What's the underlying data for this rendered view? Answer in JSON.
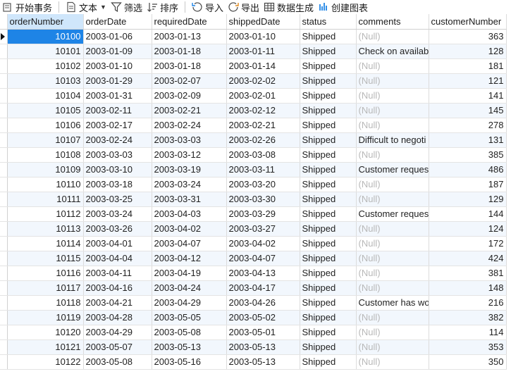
{
  "toolbar": {
    "begin_tx": "开始事务",
    "text": "文本",
    "filter": "筛选",
    "sort": "排序",
    "import": "导入",
    "export": "导出",
    "data_gen": "数据生成",
    "create_chart": "创建图表"
  },
  "columns": [
    "orderNumber",
    "orderDate",
    "requiredDate",
    "shippedDate",
    "status",
    "comments",
    "customerNumber"
  ],
  "null_text": "(Null)",
  "rows": [
    [
      "10100",
      "2003-01-06",
      "2003-01-13",
      "2003-01-10",
      "Shipped",
      "(Null)",
      "363"
    ],
    [
      "10101",
      "2003-01-09",
      "2003-01-18",
      "2003-01-11",
      "Shipped",
      "Check on availabi",
      "128"
    ],
    [
      "10102",
      "2003-01-10",
      "2003-01-18",
      "2003-01-14",
      "Shipped",
      "(Null)",
      "181"
    ],
    [
      "10103",
      "2003-01-29",
      "2003-02-07",
      "2003-02-02",
      "Shipped",
      "(Null)",
      "121"
    ],
    [
      "10104",
      "2003-01-31",
      "2003-02-09",
      "2003-02-01",
      "Shipped",
      "(Null)",
      "141"
    ],
    [
      "10105",
      "2003-02-11",
      "2003-02-21",
      "2003-02-12",
      "Shipped",
      "(Null)",
      "145"
    ],
    [
      "10106",
      "2003-02-17",
      "2003-02-24",
      "2003-02-21",
      "Shipped",
      "(Null)",
      "278"
    ],
    [
      "10107",
      "2003-02-24",
      "2003-03-03",
      "2003-02-26",
      "Shipped",
      "Difficult to negoti",
      "131"
    ],
    [
      "10108",
      "2003-03-03",
      "2003-03-12",
      "2003-03-08",
      "Shipped",
      "(Null)",
      "385"
    ],
    [
      "10109",
      "2003-03-10",
      "2003-03-19",
      "2003-03-11",
      "Shipped",
      "Customer request",
      "486"
    ],
    [
      "10110",
      "2003-03-18",
      "2003-03-24",
      "2003-03-20",
      "Shipped",
      "(Null)",
      "187"
    ],
    [
      "10111",
      "2003-03-25",
      "2003-03-31",
      "2003-03-30",
      "Shipped",
      "(Null)",
      "129"
    ],
    [
      "10112",
      "2003-03-24",
      "2003-04-03",
      "2003-03-29",
      "Shipped",
      "Customer request",
      "144"
    ],
    [
      "10113",
      "2003-03-26",
      "2003-04-02",
      "2003-03-27",
      "Shipped",
      "(Null)",
      "124"
    ],
    [
      "10114",
      "2003-04-01",
      "2003-04-07",
      "2003-04-02",
      "Shipped",
      "(Null)",
      "172"
    ],
    [
      "10115",
      "2003-04-04",
      "2003-04-12",
      "2003-04-07",
      "Shipped",
      "(Null)",
      "424"
    ],
    [
      "10116",
      "2003-04-11",
      "2003-04-19",
      "2003-04-13",
      "Shipped",
      "(Null)",
      "381"
    ],
    [
      "10117",
      "2003-04-16",
      "2003-04-24",
      "2003-04-17",
      "Shipped",
      "(Null)",
      "148"
    ],
    [
      "10118",
      "2003-04-21",
      "2003-04-29",
      "2003-04-26",
      "Shipped",
      "Customer has wor",
      "216"
    ],
    [
      "10119",
      "2003-04-28",
      "2003-05-05",
      "2003-05-02",
      "Shipped",
      "(Null)",
      "382"
    ],
    [
      "10120",
      "2003-04-29",
      "2003-05-08",
      "2003-05-01",
      "Shipped",
      "(Null)",
      "114"
    ],
    [
      "10121",
      "2003-05-07",
      "2003-05-13",
      "2003-05-13",
      "Shipped",
      "(Null)",
      "353"
    ],
    [
      "10122",
      "2003-05-08",
      "2003-05-16",
      "2003-05-13",
      "Shipped",
      "(Null)",
      "350"
    ]
  ],
  "colors": {
    "selection": "#1e84e6",
    "header_selected": "#cfe6fb",
    "alt_row": "#f2f7fd",
    "null_text": "#b8b8b8"
  }
}
